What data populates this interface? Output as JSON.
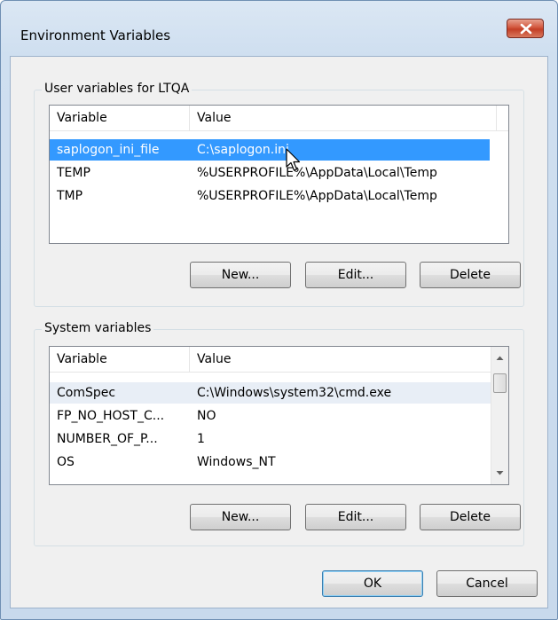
{
  "window": {
    "title": "Environment Variables",
    "close_icon": "close-icon"
  },
  "user_group": {
    "label": "User variables for LTQA",
    "columns": [
      "Variable",
      "Value"
    ],
    "rows": [
      {
        "variable": "saplogon_ini_file",
        "value": "C:\\saplogon.ini"
      },
      {
        "variable": "TEMP",
        "value": "%USERPROFILE%\\AppData\\Local\\Temp"
      },
      {
        "variable": "TMP",
        "value": "%USERPROFILE%\\AppData\\Local\\Temp"
      }
    ],
    "new_label": "New...",
    "edit_label": "Edit...",
    "delete_label": "Delete"
  },
  "system_group": {
    "label": "System variables",
    "columns": [
      "Variable",
      "Value"
    ],
    "rows": [
      {
        "variable": "ComSpec",
        "value": "C:\\Windows\\system32\\cmd.exe"
      },
      {
        "variable": "FP_NO_HOST_C...",
        "value": "NO"
      },
      {
        "variable": "NUMBER_OF_P...",
        "value": "1"
      },
      {
        "variable": "OS",
        "value": "Windows_NT"
      }
    ],
    "new_label": "New...",
    "edit_label": "Edit...",
    "delete_label": "Delete"
  },
  "footer": {
    "ok_label": "OK",
    "cancel_label": "Cancel"
  },
  "colors": {
    "selection": "#3399ff",
    "close_button": "#c9462c"
  }
}
